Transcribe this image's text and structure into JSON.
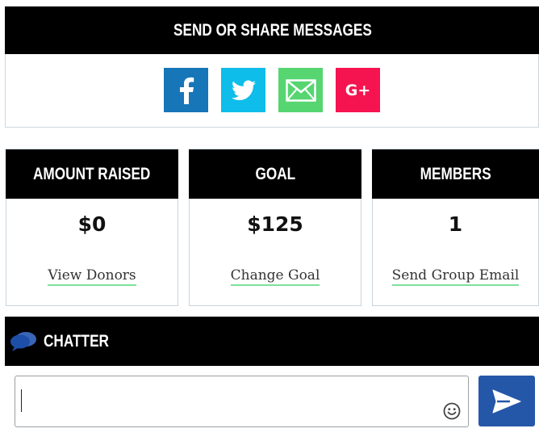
{
  "share": {
    "title": "SEND OR SHARE MESSAGES",
    "buttons": [
      {
        "name": "facebook",
        "icon": "facebook-icon",
        "color": "#1776b8"
      },
      {
        "name": "twitter",
        "icon": "twitter-icon",
        "color": "#0ebde9"
      },
      {
        "name": "email",
        "icon": "email-icon",
        "color": "#56d571"
      },
      {
        "name": "google-plus",
        "icon": "google-plus-icon",
        "color": "#f5144f",
        "text": "G+"
      }
    ]
  },
  "stats": [
    {
      "title": "AMOUNT RAISED",
      "value": "$0",
      "link": "View Donors"
    },
    {
      "title": "GOAL",
      "value": "$125",
      "link": "Change Goal"
    },
    {
      "title": "MEMBERS",
      "value": "1",
      "link": "Send Group Email"
    }
  ],
  "chatter": {
    "title": "CHATTER",
    "icon": "chat-bubbles-icon",
    "input_value": "",
    "emoji_icon": "smiley-icon",
    "send_icon": "send-icon",
    "send_color": "#2457a8",
    "link_underline_color": "#7ee09b"
  }
}
